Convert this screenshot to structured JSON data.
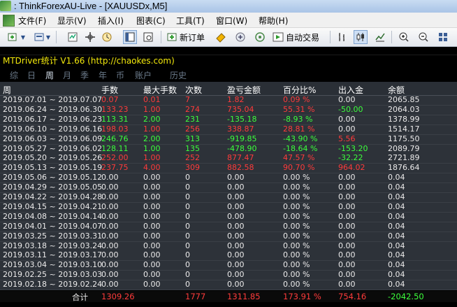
{
  "window": {
    "title": ": ThinkForexAU-Live - [XAUUSDx,M5]"
  },
  "menu": {
    "items": [
      "文件(F)",
      "显示(V)",
      "插入(I)",
      "图表(C)",
      "工具(T)",
      "窗口(W)",
      "帮助(H)"
    ]
  },
  "toolbar": {
    "new_order_label": "新订单",
    "autotrade_label": "自动交易"
  },
  "indicator": {
    "title": "MTDriver统计 V1.66  (http://chaokes.com)",
    "tabs": [
      "综",
      "日",
      "周",
      "月",
      "季",
      "年",
      "币",
      "账户",
      "历史"
    ],
    "active_tab": "周"
  },
  "table": {
    "headers": [
      "周",
      "手数",
      "最大手数",
      "次数",
      "盈亏金额",
      "百分比%",
      "出入金",
      "余额"
    ],
    "rows": [
      {
        "period": "2019.07.01 ~ 2019.07.07",
        "lots": "0.07",
        "max_lots": "0.01",
        "count": "7",
        "pnl": "1.82",
        "pct": "0.09 %",
        "flow": "0.00",
        "balance": "2065.85",
        "c": [
          "red",
          "red",
          "red",
          "red",
          "red",
          "white",
          "white"
        ]
      },
      {
        "period": "2019.06.24 ~ 2019.06.30",
        "lots": "133.23",
        "max_lots": "1.00",
        "count": "274",
        "pnl": "735.04",
        "pct": "55.31 %",
        "flow": "-50.00",
        "balance": "2064.03",
        "c": [
          "red",
          "red",
          "red",
          "red",
          "red",
          "green",
          "white"
        ]
      },
      {
        "period": "2019.06.17 ~ 2019.06.23",
        "lots": "113.31",
        "max_lots": "2.00",
        "count": "231",
        "pnl": "-135.18",
        "pct": "-8.93 %",
        "flow": "0.00",
        "balance": "1378.99",
        "c": [
          "green",
          "green",
          "green",
          "green",
          "green",
          "white",
          "white"
        ]
      },
      {
        "period": "2019.06.10 ~ 2019.06.16",
        "lots": "198.03",
        "max_lots": "1.00",
        "count": "256",
        "pnl": "338.87",
        "pct": "28.81 %",
        "flow": "0.00",
        "balance": "1514.17",
        "c": [
          "red",
          "red",
          "red",
          "red",
          "red",
          "white",
          "white"
        ]
      },
      {
        "period": "2019.06.03 ~ 2019.06.09",
        "lots": "246.76",
        "max_lots": "2.00",
        "count": "313",
        "pnl": "-919.85",
        "pct": "-43.90 %",
        "flow": "5.56",
        "balance": "1175.50",
        "c": [
          "green",
          "green",
          "green",
          "green",
          "green",
          "red",
          "white"
        ]
      },
      {
        "period": "2019.05.27 ~ 2019.06.02",
        "lots": "128.11",
        "max_lots": "1.00",
        "count": "135",
        "pnl": "-478.90",
        "pct": "-18.64 %",
        "flow": "-153.20",
        "balance": "2089.79",
        "c": [
          "green",
          "green",
          "green",
          "green",
          "green",
          "green",
          "white"
        ]
      },
      {
        "period": "2019.05.20 ~ 2019.05.26",
        "lots": "252.00",
        "max_lots": "1.00",
        "count": "252",
        "pnl": "877.47",
        "pct": "47.57 %",
        "flow": "-32.22",
        "balance": "2721.89",
        "c": [
          "red",
          "red",
          "red",
          "red",
          "red",
          "green",
          "white"
        ]
      },
      {
        "period": "2019.05.13 ~ 2019.05.19",
        "lots": "237.75",
        "max_lots": "4.00",
        "count": "309",
        "pnl": "882.58",
        "pct": "90.70 %",
        "flow": "964.02",
        "balance": "1876.64",
        "c": [
          "red",
          "red",
          "red",
          "red",
          "red",
          "red",
          "white"
        ]
      },
      {
        "period": "2019.05.06 ~ 2019.05.12",
        "lots": "0.00",
        "max_lots": "0.00",
        "count": "0",
        "pnl": "0.00",
        "pct": "0.00 %",
        "flow": "0.00",
        "balance": "0.04",
        "c": [
          "white",
          "white",
          "white",
          "white",
          "white",
          "white",
          "white"
        ]
      },
      {
        "period": "2019.04.29 ~ 2019.05.05",
        "lots": "0.00",
        "max_lots": "0.00",
        "count": "0",
        "pnl": "0.00",
        "pct": "0.00 %",
        "flow": "0.00",
        "balance": "0.04",
        "c": [
          "white",
          "white",
          "white",
          "white",
          "white",
          "white",
          "white"
        ]
      },
      {
        "period": "2019.04.22 ~ 2019.04.28",
        "lots": "0.00",
        "max_lots": "0.00",
        "count": "0",
        "pnl": "0.00",
        "pct": "0.00 %",
        "flow": "0.00",
        "balance": "0.04",
        "c": [
          "white",
          "white",
          "white",
          "white",
          "white",
          "white",
          "white"
        ]
      },
      {
        "period": "2019.04.15 ~ 2019.04.21",
        "lots": "0.00",
        "max_lots": "0.00",
        "count": "0",
        "pnl": "0.00",
        "pct": "0.00 %",
        "flow": "0.00",
        "balance": "0.04",
        "c": [
          "white",
          "white",
          "white",
          "white",
          "white",
          "white",
          "white"
        ]
      },
      {
        "period": "2019.04.08 ~ 2019.04.14",
        "lots": "0.00",
        "max_lots": "0.00",
        "count": "0",
        "pnl": "0.00",
        "pct": "0.00 %",
        "flow": "0.00",
        "balance": "0.04",
        "c": [
          "white",
          "white",
          "white",
          "white",
          "white",
          "white",
          "white"
        ]
      },
      {
        "period": "2019.04.01 ~ 2019.04.07",
        "lots": "0.00",
        "max_lots": "0.00",
        "count": "0",
        "pnl": "0.00",
        "pct": "0.00 %",
        "flow": "0.00",
        "balance": "0.04",
        "c": [
          "white",
          "white",
          "white",
          "white",
          "white",
          "white",
          "white"
        ]
      },
      {
        "period": "2019.03.25 ~ 2019.03.31",
        "lots": "0.00",
        "max_lots": "0.00",
        "count": "0",
        "pnl": "0.00",
        "pct": "0.00 %",
        "flow": "0.00",
        "balance": "0.04",
        "c": [
          "white",
          "white",
          "white",
          "white",
          "white",
          "white",
          "white"
        ]
      },
      {
        "period": "2019.03.18 ~ 2019.03.24",
        "lots": "0.00",
        "max_lots": "0.00",
        "count": "0",
        "pnl": "0.00",
        "pct": "0.00 %",
        "flow": "0.00",
        "balance": "0.04",
        "c": [
          "white",
          "white",
          "white",
          "white",
          "white",
          "white",
          "white"
        ]
      },
      {
        "period": "2019.03.11 ~ 2019.03.17",
        "lots": "0.00",
        "max_lots": "0.00",
        "count": "0",
        "pnl": "0.00",
        "pct": "0.00 %",
        "flow": "0.00",
        "balance": "0.04",
        "c": [
          "white",
          "white",
          "white",
          "white",
          "white",
          "white",
          "white"
        ]
      },
      {
        "period": "2019.03.04 ~ 2019.03.10",
        "lots": "0.00",
        "max_lots": "0.00",
        "count": "0",
        "pnl": "0.00",
        "pct": "0.00 %",
        "flow": "0.00",
        "balance": "0.04",
        "c": [
          "white",
          "white",
          "white",
          "white",
          "white",
          "white",
          "white"
        ]
      },
      {
        "period": "2019.02.25 ~ 2019.03.03",
        "lots": "0.00",
        "max_lots": "0.00",
        "count": "0",
        "pnl": "0.00",
        "pct": "0.00 %",
        "flow": "0.00",
        "balance": "0.04",
        "c": [
          "white",
          "white",
          "white",
          "white",
          "white",
          "white",
          "white"
        ]
      },
      {
        "period": "2019.02.18 ~ 2019.02.24",
        "lots": "0.00",
        "max_lots": "0.00",
        "count": "0",
        "pnl": "0.00",
        "pct": "0.00 %",
        "flow": "0.00",
        "balance": "0.04",
        "c": [
          "white",
          "white",
          "white",
          "white",
          "white",
          "white",
          "white"
        ]
      }
    ],
    "total": {
      "label": "合计",
      "lots": "1309.26",
      "max_lots": "",
      "count": "1777",
      "pnl": "1311.85",
      "pct": "173.91 %",
      "flow": "754.16",
      "balance": "-2042.50"
    }
  },
  "colors": {
    "profit": "#ff3b3b",
    "loss": "#3cff3c",
    "title": "#f3e90b",
    "header_bg": "#2a2f36",
    "row_bg": "#2d3239"
  }
}
